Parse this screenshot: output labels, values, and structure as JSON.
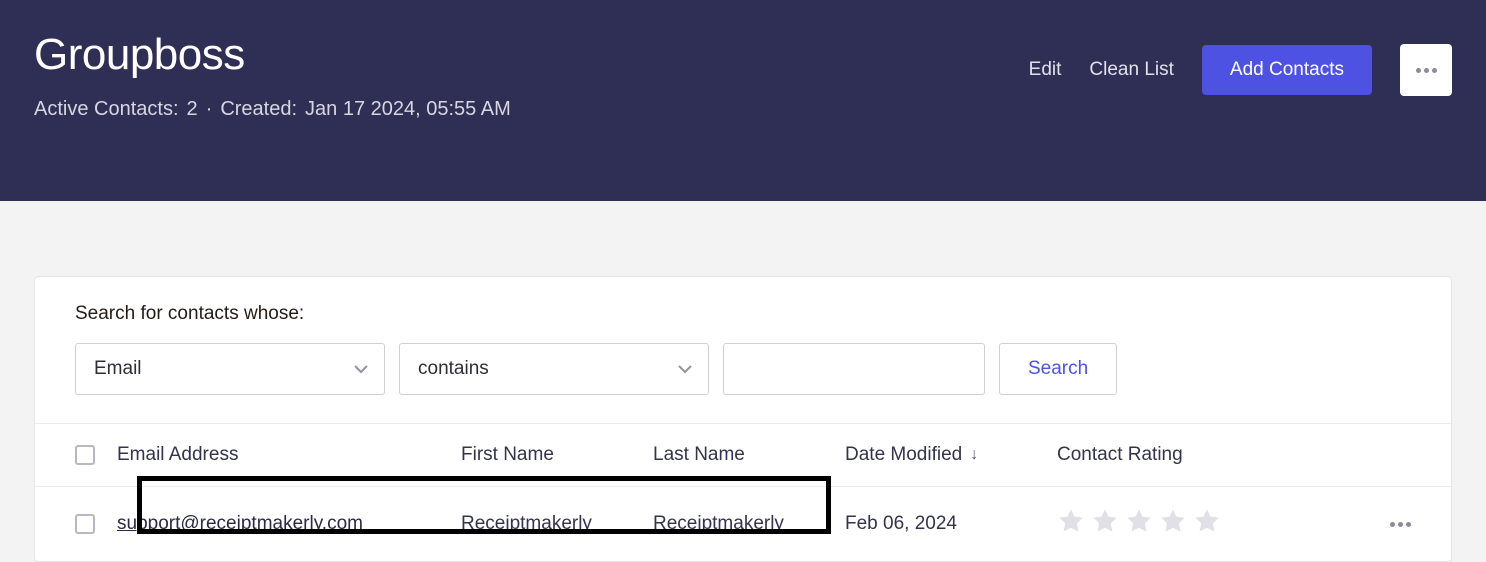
{
  "header": {
    "title": "Groupboss",
    "active_contacts_label": "Active Contacts:",
    "active_contacts_count": "2",
    "created_label": "Created:",
    "created_value": "Jan 17 2024, 05:55 AM",
    "edit_label": "Edit",
    "clean_list_label": "Clean List",
    "add_contacts_label": "Add Contacts"
  },
  "search": {
    "label": "Search for contacts whose:",
    "field_value": "Email",
    "operator_value": "contains",
    "query_value": "",
    "button_label": "Search"
  },
  "table": {
    "columns": {
      "email": "Email Address",
      "first": "First Name",
      "last": "Last Name",
      "date": "Date Modified",
      "rating": "Contact Rating"
    },
    "rows": [
      {
        "email": "support@receiptmakerly.com",
        "first": "Receiptmakerly",
        "last": "Receiptmakerly",
        "date": "Feb 06, 2024"
      }
    ]
  }
}
